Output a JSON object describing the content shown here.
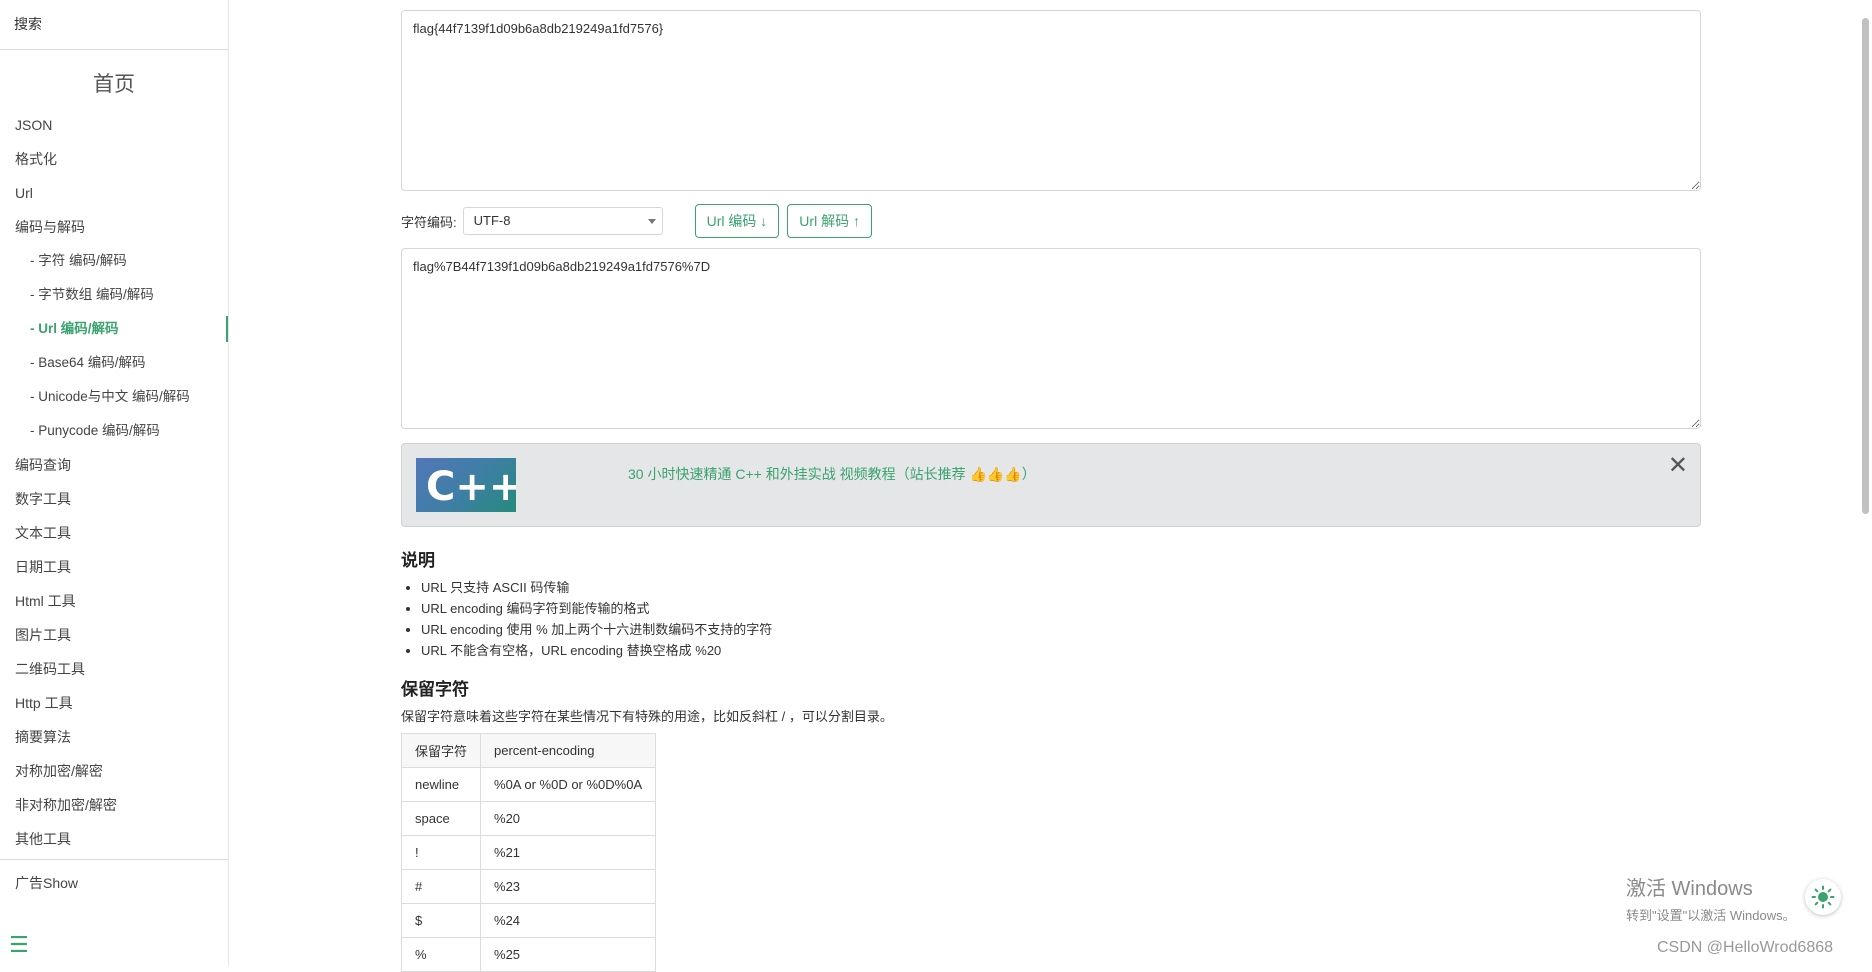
{
  "sidebar": {
    "search_label": "搜索",
    "home_label": "首页",
    "items": [
      {
        "label": "JSON",
        "sub": false,
        "active": false
      },
      {
        "label": "格式化",
        "sub": false,
        "active": false
      },
      {
        "label": "Url",
        "sub": false,
        "active": false
      },
      {
        "label": "编码与解码",
        "sub": false,
        "active": false
      },
      {
        "label": "- 字符  编码/解码",
        "sub": true,
        "active": false
      },
      {
        "label": "- 字节数组  编码/解码",
        "sub": true,
        "active": false
      },
      {
        "label": "- Url  编码/解码",
        "sub": true,
        "active": true
      },
      {
        "label": "- Base64  编码/解码",
        "sub": true,
        "active": false
      },
      {
        "label": "- Unicode与中文  编码/解码",
        "sub": true,
        "active": false
      },
      {
        "label": "- Punycode  编码/解码",
        "sub": true,
        "active": false
      },
      {
        "label": "编码查询",
        "sub": false,
        "active": false
      },
      {
        "label": "数字工具",
        "sub": false,
        "active": false
      },
      {
        "label": "文本工具",
        "sub": false,
        "active": false
      },
      {
        "label": "日期工具",
        "sub": false,
        "active": false
      },
      {
        "label": "Html 工具",
        "sub": false,
        "active": false
      },
      {
        "label": "图片工具",
        "sub": false,
        "active": false
      },
      {
        "label": "二维码工具",
        "sub": false,
        "active": false
      },
      {
        "label": "Http 工具",
        "sub": false,
        "active": false
      },
      {
        "label": "摘要算法",
        "sub": false,
        "active": false
      },
      {
        "label": "对称加密/解密",
        "sub": false,
        "active": false
      },
      {
        "label": "非对称加密/解密",
        "sub": false,
        "active": false
      },
      {
        "label": "其他工具",
        "sub": false,
        "active": false
      }
    ],
    "ad_show_label": "广告Show",
    "menu_icon": "hamburger-icon"
  },
  "main": {
    "input_value": "flag{44f7139f1d09b6a8db219249a1fd7576}",
    "charset_label": "字符编码:",
    "charset_value": "UTF-8",
    "encode_button": "Url 编码 ↓",
    "decode_button": "Url 解码 ↑",
    "output_value": "flag%7B44f7139f1d09b6a8db219249a1fd7576%7D"
  },
  "ad": {
    "logo_text": "C++",
    "text": "30 小时快速精通 C++ 和外挂实战 视频教程（站长推荐 👍👍👍）",
    "close_icon": "close-icon"
  },
  "description": {
    "title": "说明",
    "points": [
      "URL 只支持 ASCII 码传输",
      "URL encoding 编码字符到能传输的格式",
      "URL encoding 使用 % 加上两个十六进制数编码不支持的字符",
      "URL 不能含有空格，URL encoding 替换空格成 %20"
    ]
  },
  "reserved": {
    "title": "保留字符",
    "intro": "保留字符意味着这些字符在某些情况下有特殊的用途，比如反斜杠 / ，可以分割目录。",
    "headers": [
      "保留字符",
      "percent-encoding"
    ],
    "rows": [
      [
        "newline",
        "%0A or %0D or %0D%0A"
      ],
      [
        "space",
        "%20"
      ],
      [
        "!",
        "%21"
      ],
      [
        "#",
        "%23"
      ],
      [
        "$",
        "%24"
      ],
      [
        "%",
        "%25"
      ]
    ]
  },
  "overlay": {
    "watermark_title": "激活 Windows",
    "watermark_sub": "转到\"设置\"以激活 Windows。",
    "csdn_label": "CSDN @HelloWrod6868",
    "theme_icon": "sun-icon"
  },
  "colors": {
    "accent": "#3aa36e",
    "ad_bg": "#e4e6e8"
  }
}
